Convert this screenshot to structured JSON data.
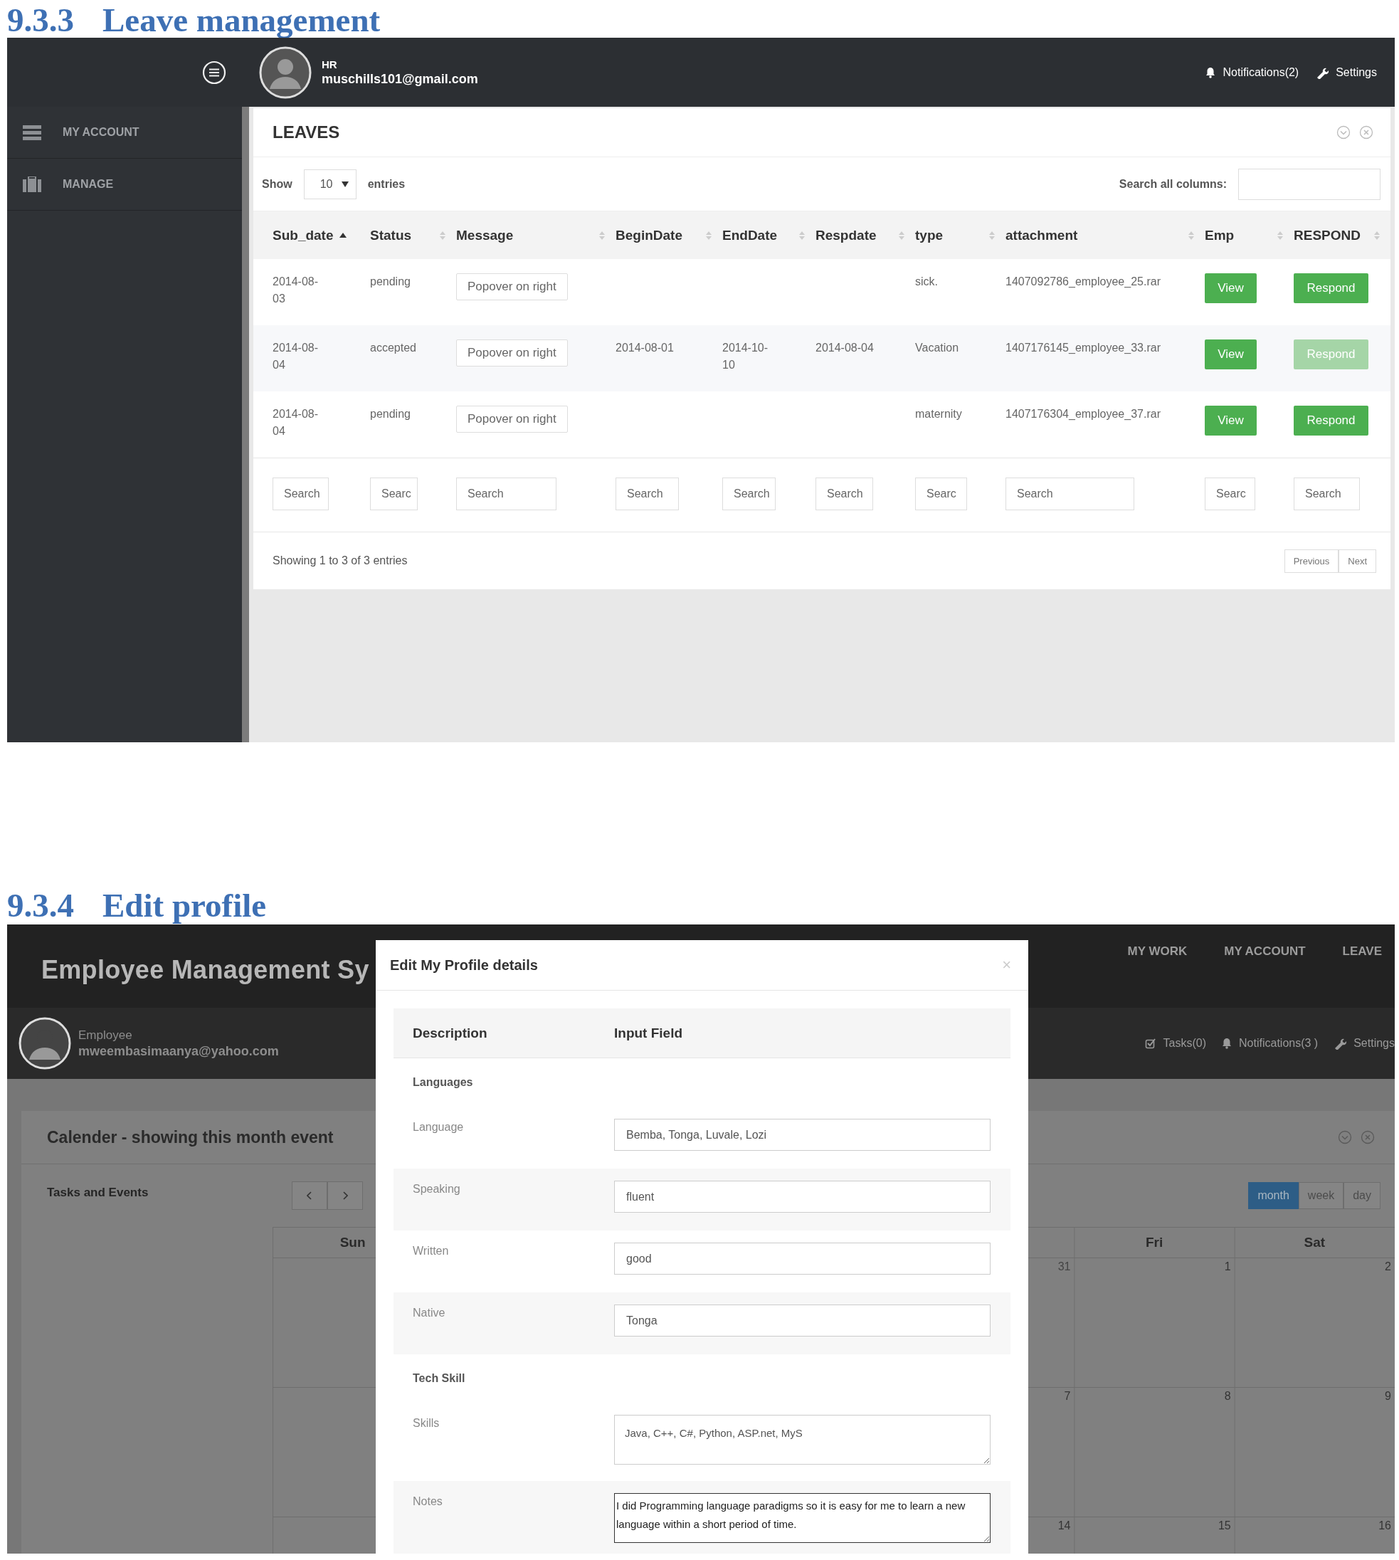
{
  "leave_management": {
    "heading": {
      "number": "9.3.3",
      "title": "Leave management"
    },
    "sidebar": {
      "items": [
        {
          "kind": "list",
          "label": "MY ACCOUNT"
        },
        {
          "kind": "briefcase",
          "label": "MANAGE"
        }
      ]
    },
    "header": {
      "role": "HR",
      "email": "muschills101@gmail.com",
      "links": [
        {
          "kind": "bell",
          "label": "Notifications(2)"
        },
        {
          "kind": "wrench",
          "label": "Settings"
        }
      ]
    },
    "panel": {
      "title": "LEAVES",
      "show_label": "Show",
      "page_size": "10",
      "entries_label": "entries",
      "search_label": "Search all columns:",
      "columns": [
        {
          "label": "Sub_date",
          "sorted": true
        },
        {
          "label": "Status",
          "sorted": false
        },
        {
          "label": "Message",
          "sorted": false
        },
        {
          "label": "BeginDate",
          "sorted": false
        },
        {
          "label": "EndDate",
          "sorted": false
        },
        {
          "label": "Respdate",
          "sorted": false
        },
        {
          "label": "type",
          "sorted": false
        },
        {
          "label": "attachment",
          "sorted": false
        },
        {
          "label": "Emp",
          "sorted": false
        },
        {
          "label": "RESPOND",
          "sorted": false
        }
      ],
      "rows": [
        {
          "sub_date": "2014-08-03",
          "status": "pending",
          "message": "Popover on right",
          "type": "sick.",
          "attachment": "1407092786_employee_25.rar",
          "emp": "View",
          "respond": {
            "label": "Respond",
            "disabled": false
          }
        },
        {
          "sub_date": "2014-08-04",
          "status": "accepted",
          "message": "Popover on right",
          "begin_date": "2014-08-01",
          "end_date": "2014-10-10",
          "respdate": "2014-08-04",
          "type": "Vacation",
          "attachment": "1407176145_employee_33.rar",
          "emp": "View",
          "respond": {
            "label": "Respond",
            "disabled": true
          }
        },
        {
          "sub_date": "2014-08-04",
          "status": "pending",
          "message": "Popover on right",
          "type": "maternity",
          "attachment": "1407176304_employee_37.rar",
          "emp": "View",
          "respond": {
            "label": "Respond",
            "disabled": false
          }
        }
      ],
      "filters": [
        {
          "placeholder": "Search"
        },
        {
          "placeholder": "Searc"
        },
        {
          "placeholder": "Search"
        },
        {
          "placeholder": "Search"
        },
        {
          "placeholder": "Search"
        },
        {
          "placeholder": "Search"
        },
        {
          "placeholder": "Searc"
        },
        {
          "placeholder": "Search"
        },
        {
          "placeholder": "Searc"
        },
        {
          "placeholder": "Search"
        }
      ],
      "info": "Showing 1 to 3 of 3 entries",
      "pagination": [
        "Previous",
        "Next"
      ]
    }
  },
  "edit_profile": {
    "heading": {
      "number": "9.3.4",
      "title": "Edit profile"
    },
    "header": {
      "title": "Employee Management Sy",
      "nav": [
        "MY WORK",
        "MY ACCOUNT",
        "LEAVE"
      ],
      "role": "Employee",
      "email": "mweembasimaanya@yahoo.com",
      "links": [
        {
          "kind": "tasks",
          "label": "Tasks(0)"
        },
        {
          "kind": "bell",
          "label": "Notifications(3 )"
        },
        {
          "kind": "wrench",
          "label": "Settings"
        }
      ]
    },
    "calendar": {
      "title": "Calender - showing this month event",
      "side_label": "Tasks and Events",
      "views": [
        {
          "label": "month",
          "selected": true
        },
        {
          "label": "week",
          "selected": false
        },
        {
          "label": "day",
          "selected": false
        }
      ],
      "columns": [
        {
          "header": "Sun"
        },
        {},
        {},
        {},
        {
          "dates": [
            {
              "day": "31",
              "other_month": true
            },
            {
              "day": "7",
              "other_month": false
            },
            {
              "day": "14",
              "other_month": false
            }
          ]
        },
        {
          "header": "Fri",
          "dates": [
            {
              "day": "1",
              "other_month": false
            },
            {
              "day": "8",
              "other_month": false
            },
            {
              "day": "15",
              "other_month": false
            }
          ]
        },
        {
          "header": "Sat",
          "dates": [
            {
              "day": "2",
              "other_month": false
            },
            {
              "day": "9",
              "other_month": false
            },
            {
              "day": "16",
              "other_month": false
            }
          ]
        }
      ]
    },
    "modal": {
      "title": "Edit My Profile details",
      "close": "×",
      "columns": [
        "Description",
        "Input Field"
      ],
      "rows": [
        {
          "kind": "section",
          "label": "Languages"
        },
        {
          "kind": "input",
          "label": "Language",
          "value": "Bemba, Tonga, Luvale, Lozi"
        },
        {
          "kind": "input",
          "label": "Speaking",
          "value": "fluent"
        },
        {
          "kind": "input",
          "label": "Written",
          "value": "good"
        },
        {
          "kind": "input",
          "label": "Native",
          "value": "Tonga"
        },
        {
          "kind": "section",
          "label": "Tech Skill"
        },
        {
          "kind": "textarea",
          "label": "Skills",
          "value": "Java, C++, C#, Python, ASP.net, MyS",
          "focused": false
        },
        {
          "kind": "textarea",
          "label": "Notes",
          "value": "I did Programming language paradigms so it is easy for me to learn a new language within a short period of time.",
          "focused": true
        }
      ]
    }
  }
}
